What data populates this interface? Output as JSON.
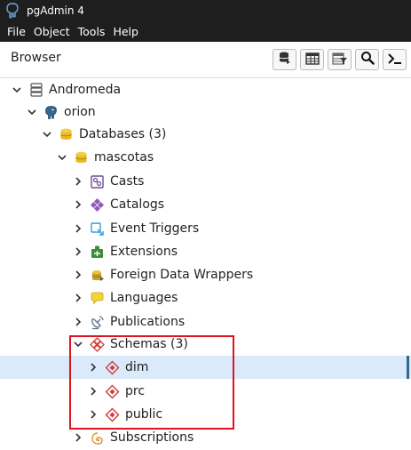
{
  "app": {
    "title": "pgAdmin 4",
    "icon": "elephant-icon"
  },
  "menubar": {
    "items": [
      "File",
      "Object",
      "Tools",
      "Help"
    ]
  },
  "browser": {
    "title": "Browser",
    "toolbar": [
      "database-icon",
      "table-icon",
      "filter-table-icon",
      "search-icon",
      "terminal-icon"
    ]
  },
  "tree": {
    "nodes": [
      {
        "label": "Andromeda",
        "icon": "server-group-icon",
        "expanded": true
      },
      {
        "label": "orion",
        "icon": "postgres-server-icon",
        "expanded": true
      },
      {
        "label": "Databases (3)",
        "icon": "databases-icon",
        "expanded": true
      },
      {
        "label": "mascotas",
        "icon": "database-icon",
        "expanded": true
      },
      {
        "label": "Casts",
        "icon": "cast-icon",
        "expanded": false
      },
      {
        "label": "Catalogs",
        "icon": "catalog-icon",
        "expanded": false
      },
      {
        "label": "Event Triggers",
        "icon": "event-trigger-icon",
        "expanded": false
      },
      {
        "label": "Extensions",
        "icon": "extension-icon",
        "expanded": false
      },
      {
        "label": "Foreign Data Wrappers",
        "icon": "fdw-icon",
        "expanded": false
      },
      {
        "label": "Languages",
        "icon": "language-icon",
        "expanded": false
      },
      {
        "label": "Publications",
        "icon": "publication-icon",
        "expanded": false
      },
      {
        "label": "Schemas (3)",
        "icon": "schemas-icon",
        "expanded": true
      },
      {
        "label": "dim",
        "icon": "schema-icon",
        "expanded": false,
        "selected": true
      },
      {
        "label": "prc",
        "icon": "schema-icon",
        "expanded": false
      },
      {
        "label": "public",
        "icon": "schema-icon",
        "expanded": false
      },
      {
        "label": "Subscriptions",
        "icon": "subscription-icon",
        "expanded": false
      }
    ]
  },
  "colors": {
    "titlebar": "#1e1e1e",
    "selection": "#dbeafb",
    "selection_marker": "#326690",
    "annotation": "#e0141e"
  }
}
